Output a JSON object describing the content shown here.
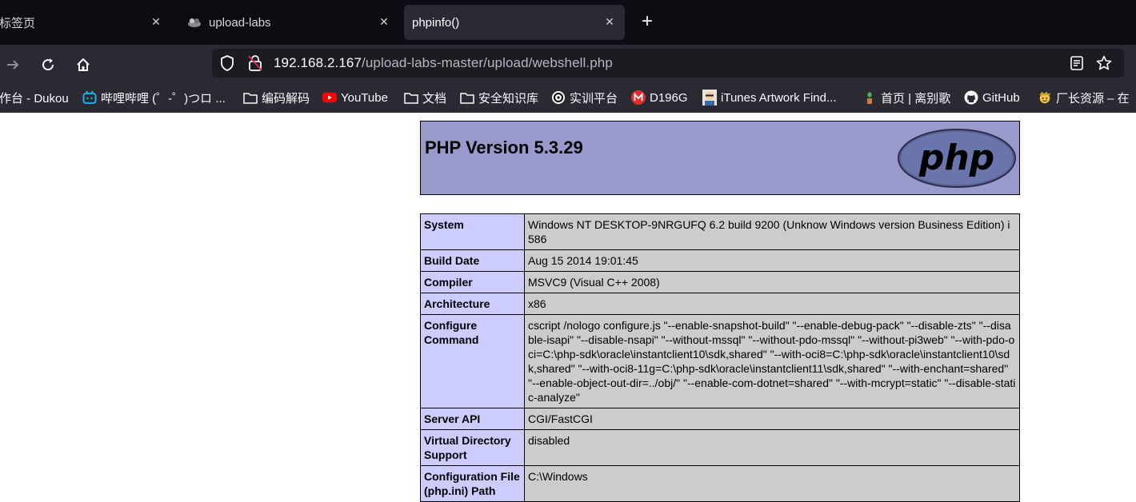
{
  "browser": {
    "tabs": [
      {
        "label": "新标签页",
        "active": false
      },
      {
        "label": "upload-labs",
        "active": false
      },
      {
        "label": "phpinfo()",
        "active": true
      }
    ],
    "url_host": "192.168.2.167",
    "url_path": "/upload-labs-master/upload/webshell.php",
    "bookmarks": [
      {
        "label": "工作台 - Dukou",
        "icon": "none"
      },
      {
        "label": "哔哩哔哩 (゜-゜)つロ ...",
        "icon": "bilibili-icon"
      },
      {
        "label": "编码解码",
        "icon": "folder-icon"
      },
      {
        "label": "YouTube",
        "icon": "youtube-icon"
      },
      {
        "label": "文档",
        "icon": "folder-icon"
      },
      {
        "label": "安全知识库",
        "icon": "folder-icon"
      },
      {
        "label": "实训平台",
        "icon": "training-icon"
      },
      {
        "label": "D196G",
        "icon": "m-icon"
      },
      {
        "label": "iTunes Artwork Find...",
        "icon": "avatar-icon"
      },
      {
        "label": "首页 | 离别歌",
        "icon": "plant-icon"
      },
      {
        "label": "GitHub",
        "icon": "github-icon"
      },
      {
        "label": "厂长资源 – 在",
        "icon": "emoji-icon"
      }
    ]
  },
  "page": {
    "title": "PHP Version 5.3.29",
    "rows": [
      {
        "key": "System",
        "value": "Windows NT DESKTOP-9NRGUFQ 6.2 build 9200 (Unknow Windows version Business Edition) i586"
      },
      {
        "key": "Build Date",
        "value": "Aug 15 2014 19:01:45"
      },
      {
        "key": "Compiler",
        "value": "MSVC9 (Visual C++ 2008)"
      },
      {
        "key": "Architecture",
        "value": "x86"
      },
      {
        "key": "Configure Command",
        "value": "cscript /nologo configure.js \"--enable-snapshot-build\" \"--enable-debug-pack\" \"--disable-zts\" \"--disable-isapi\" \"--disable-nsapi\" \"--without-mssql\" \"--without-pdo-mssql\" \"--without-pi3web\" \"--with-pdo-oci=C:\\php-sdk\\oracle\\instantclient10\\sdk,shared\" \"--with-oci8=C:\\php-sdk\\oracle\\instantclient10\\sdk,shared\" \"--with-oci8-11g=C:\\php-sdk\\oracle\\instantclient11\\sdk,shared\" \"--with-enchant=shared\" \"--enable-object-out-dir=../obj/\" \"--enable-com-dotnet=shared\" \"--with-mcrypt=static\" \"--disable-static-analyze\""
      },
      {
        "key": "Server API",
        "value": "CGI/FastCGI"
      },
      {
        "key": "Virtual Directory Support",
        "value": "disabled"
      },
      {
        "key": "Configuration File (php.ini) Path",
        "value": "C:\\Windows"
      }
    ]
  }
}
